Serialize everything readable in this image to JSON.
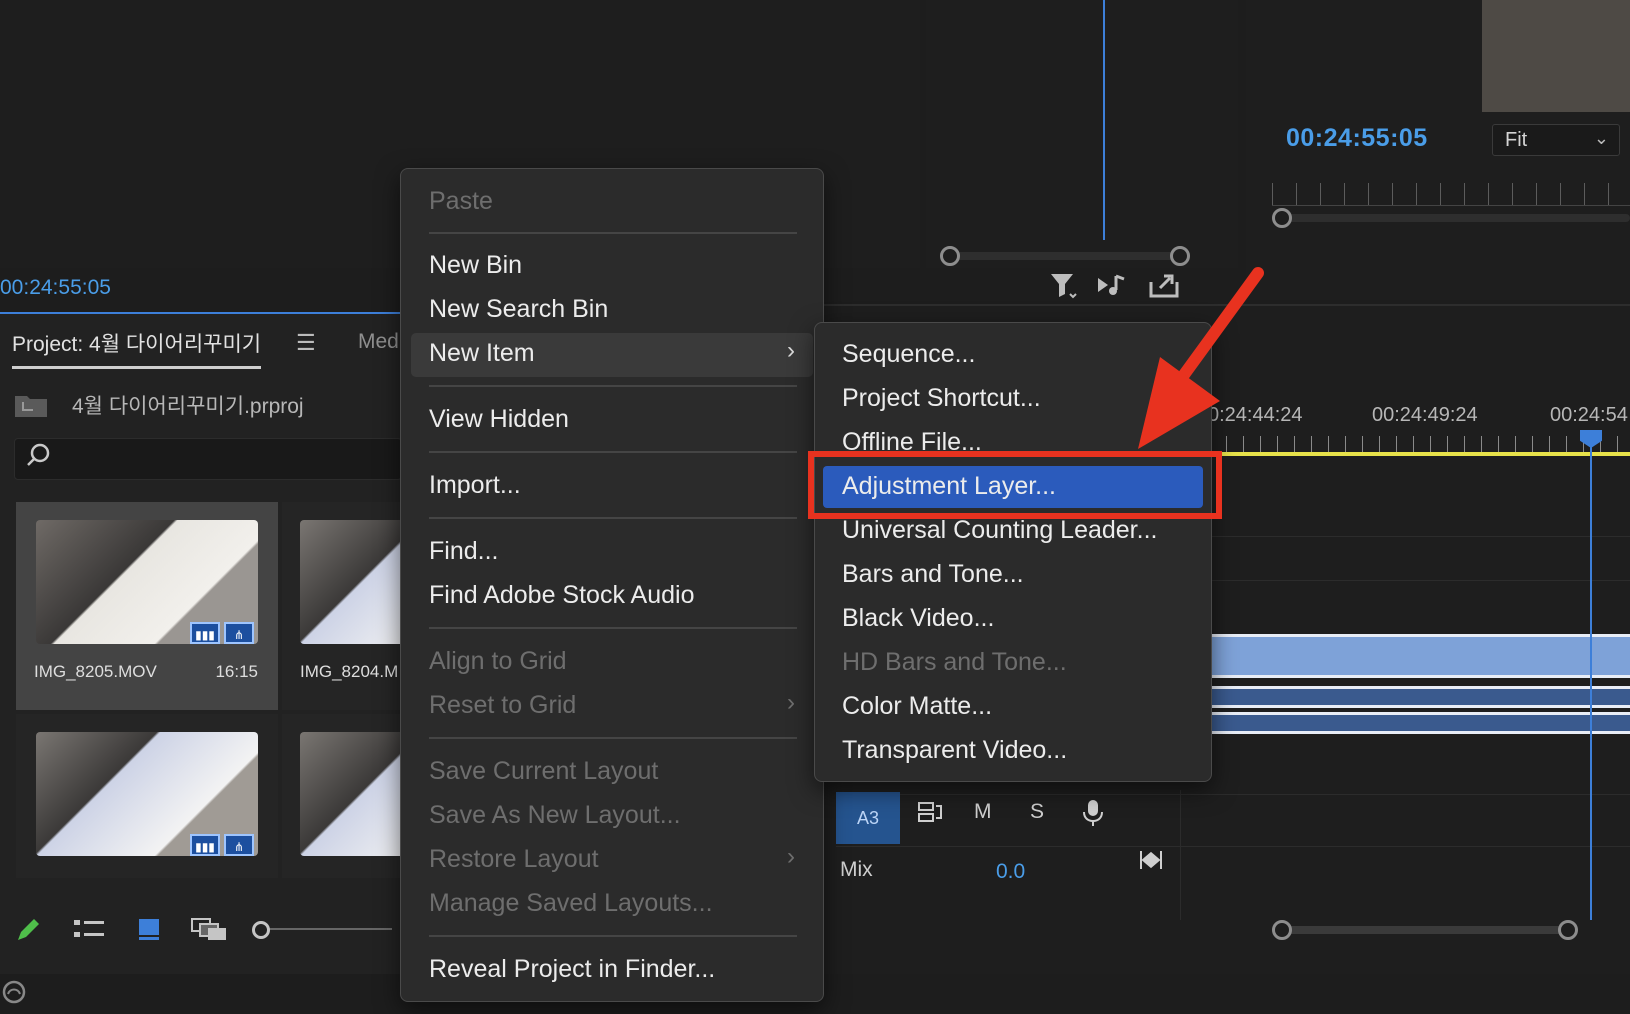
{
  "source_monitor": {
    "timecode": "00:24:55:05"
  },
  "program_monitor": {
    "timecode": "00:24:55:05",
    "zoom": "Fit"
  },
  "project_panel": {
    "tab_label": "Project: 4월 다이어리꾸미기",
    "med_tab_label": "Med",
    "project_file": "4월 다이어리꾸미기.prproj",
    "items": [
      {
        "name": "IMG_8205.MOV",
        "duration": "16:15"
      },
      {
        "name": "IMG_8204.M",
        "duration": ""
      }
    ]
  },
  "timeline": {
    "ruler_timecodes": [
      "0:24:44:24",
      "00:24:49:24",
      "00:24:54"
    ],
    "track_a3": {
      "label": "A3",
      "m": "M",
      "s": "S"
    },
    "mix": {
      "label": "Mix",
      "value": "0.0"
    }
  },
  "context_menu": {
    "items": {
      "paste": "Paste",
      "new_bin": "New Bin",
      "new_search_bin": "New Search Bin",
      "new_item": "New Item",
      "view_hidden": "View Hidden",
      "import": "Import...",
      "find": "Find...",
      "find_stock": "Find Adobe Stock Audio",
      "align_grid": "Align to Grid",
      "reset_grid": "Reset to Grid",
      "save_layout": "Save Current Layout",
      "save_new_layout": "Save As New Layout...",
      "restore_layout": "Restore Layout",
      "manage_layouts": "Manage Saved Layouts...",
      "reveal_finder": "Reveal Project in Finder..."
    }
  },
  "new_item_submenu": {
    "items": {
      "sequence": "Sequence...",
      "project_shortcut": "Project Shortcut...",
      "offline_file": "Offline File...",
      "adjustment_layer": "Adjustment Layer...",
      "universal_leader": "Universal Counting Leader...",
      "bars_tone": "Bars and Tone...",
      "black_video": "Black Video...",
      "hd_bars_tone": "HD Bars and Tone...",
      "color_matte": "Color Matte...",
      "transparent_video": "Transparent Video..."
    }
  },
  "icons": {
    "filter": "filter-icon",
    "audio": "audio-insert-icon",
    "export": "export-icon",
    "search": "search-icon",
    "pencil": "pencil-icon",
    "list_view": "list-view-icon",
    "icon_view": "icon-view-icon",
    "freeform_view": "freeform-view-icon",
    "mic": "microphone-icon"
  },
  "colors": {
    "accent_blue": "#4a9de8",
    "highlight_blue": "#2b5bbc",
    "annotation_red": "#e8321f",
    "timeline_yellow": "#e7e24a"
  }
}
